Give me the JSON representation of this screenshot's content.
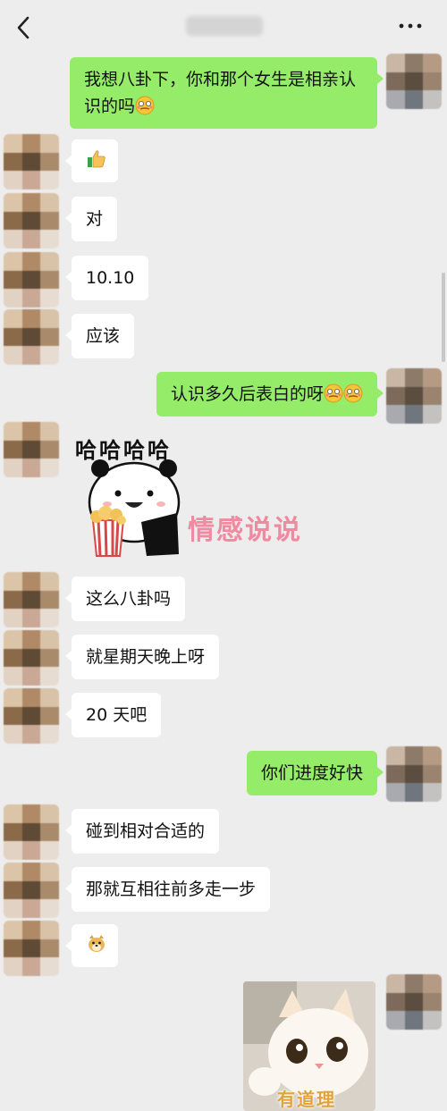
{
  "header": {
    "back_icon": "chevron-left-icon",
    "title": "",
    "more_icon": "more-dots-icon"
  },
  "messages": [
    {
      "side": "out",
      "text": "我想八卦下，你和那个女生是相亲认识的吗",
      "emoji": [
        "awkward-smile"
      ]
    },
    {
      "side": "in",
      "text": "",
      "emoji": [
        "thumbs-up"
      ]
    },
    {
      "side": "in",
      "text": "对"
    },
    {
      "side": "in",
      "text": "10.10"
    },
    {
      "side": "in",
      "text": "应该"
    },
    {
      "side": "out",
      "text": "认识多久后表白的呀",
      "emoji": [
        "awkward-smile",
        "awkward-smile"
      ]
    },
    {
      "side": "in",
      "sticker": "panda-popcorn",
      "caption": "哈哈哈哈"
    },
    {
      "side": "in",
      "text": "这么八卦吗"
    },
    {
      "side": "in",
      "text": "就星期天晚上呀"
    },
    {
      "side": "in",
      "text": "20 天吧"
    },
    {
      "side": "out",
      "text": "你们进度好快"
    },
    {
      "side": "in",
      "text": "碰到相对合适的"
    },
    {
      "side": "in",
      "text": "那就互相往前多走一步"
    },
    {
      "side": "in",
      "text": "",
      "emoji": [
        "doge"
      ]
    },
    {
      "side": "out",
      "sticker": "cat-photo",
      "caption": "有道理"
    }
  ],
  "watermark": "情感说说"
}
